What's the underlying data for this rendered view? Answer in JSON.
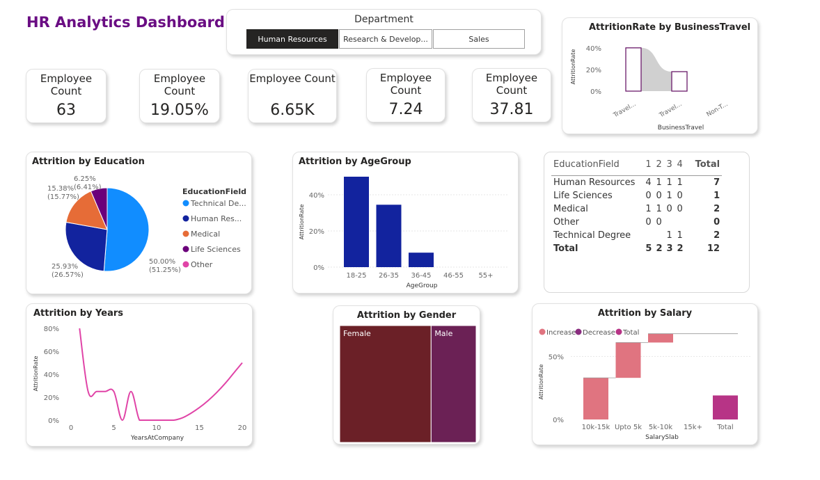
{
  "dashboard_title": "HR Analytics Dashboard",
  "slicer": {
    "title": "Department",
    "options": [
      "Human Resources",
      "Research & Develop...",
      "Sales"
    ],
    "selected": "Human Resources"
  },
  "kpis": [
    {
      "label": "Employee Count",
      "value": "63"
    },
    {
      "label": "Employee Count",
      "value": "19.05%"
    },
    {
      "label": "Employee Count",
      "value": "6.65K"
    },
    {
      "label": "Employee Count",
      "value": "7.24"
    },
    {
      "label": "Employee Count",
      "value": "37.81"
    }
  ],
  "colors": {
    "title_purple": "#6a0d83",
    "education": [
      "#118dff",
      "#12239e",
      "#e66c37",
      "#6b007b",
      "#e044a7"
    ],
    "age_bar": "#12239e",
    "years_line": "#e044a7",
    "gender_female": "#6b2027",
    "gender_male": "#6b2155",
    "salary_increase": "#e07480",
    "salary_decrease": "#8a2d7f",
    "salary_total": "#b73486",
    "travel_bar_border": "#6a1a6a",
    "travel_ribbon": "#c8c8c8"
  },
  "chart_data": [
    {
      "id": "travel",
      "type": "bar",
      "title": "AttritionRate by BusinessTravel",
      "xlabel": "BusinessTravel",
      "ylabel": "AttritionRate",
      "categories": [
        "Travel...",
        "Travel...",
        "Non-T..."
      ],
      "values": [
        40,
        18,
        0
      ],
      "ylim": [
        0,
        45
      ],
      "yticks": [
        "0%",
        "20%",
        "40%"
      ],
      "ytick_values": [
        0,
        20,
        40
      ]
    },
    {
      "id": "education",
      "type": "pie",
      "title": "Attrition by Education",
      "legend_title": "EducationField",
      "legend": [
        "Technical De...",
        "Human Res...",
        "Medical",
        "Life Sciences",
        "Other"
      ],
      "values": [
        51.25,
        26.57,
        15.77,
        6.41,
        0
      ],
      "labels": [
        {
          "pct": "50.00%",
          "sub": "(51.25%)"
        },
        {
          "pct": "25.93%",
          "sub": "(26.57%)"
        },
        {
          "pct": "15.38%",
          "sub": "(15.77%)"
        },
        {
          "pct": "6.25%",
          "sub": "(6.41%)"
        }
      ]
    },
    {
      "id": "age",
      "type": "bar",
      "title": "Attrition by AgeGroup",
      "xlabel": "AgeGroup",
      "ylabel": "AttritionRate",
      "categories": [
        "18-25",
        "26-35",
        "36-45",
        "46-55",
        "55+"
      ],
      "values": [
        50,
        34.5,
        8,
        0,
        0
      ],
      "ylim": [
        0,
        50
      ],
      "yticks": [
        "0%",
        "20%",
        "40%"
      ],
      "ytick_values": [
        0,
        20,
        40
      ]
    },
    {
      "id": "table",
      "type": "table",
      "corner": "EducationField",
      "columns": [
        "1",
        "2",
        "3",
        "4",
        "Total"
      ],
      "rows": [
        {
          "name": "Human Resources",
          "cells": [
            "4",
            "1",
            "1",
            "1",
            "7"
          ]
        },
        {
          "name": "Life Sciences",
          "cells": [
            "0",
            "0",
            "1",
            "0",
            "1"
          ]
        },
        {
          "name": "Medical",
          "cells": [
            "1",
            "1",
            "0",
            "0",
            "2"
          ]
        },
        {
          "name": "Other",
          "cells": [
            "0",
            "0",
            "",
            "",
            "0"
          ]
        },
        {
          "name": "Technical Degree",
          "cells": [
            "",
            "",
            "1",
            "1",
            "2"
          ]
        }
      ],
      "total": {
        "name": "Total",
        "cells": [
          "5",
          "2",
          "3",
          "2",
          "12"
        ]
      }
    },
    {
      "id": "years",
      "type": "line",
      "title": "Attrition by Years",
      "xlabel": "YearsAtCompany",
      "ylabel": "AttritionRate",
      "x": [
        1,
        2,
        3,
        4,
        5,
        6,
        7,
        8,
        9,
        10,
        11,
        12,
        13,
        14,
        15,
        16,
        17,
        18,
        19,
        20
      ],
      "y": [
        80,
        25,
        25,
        25,
        25,
        0,
        25,
        0,
        0,
        0,
        0,
        0,
        2,
        6,
        11,
        17,
        24,
        32,
        41,
        50
      ],
      "xlim": [
        0,
        20
      ],
      "ylim": [
        0,
        80
      ],
      "xticks": [
        0,
        5,
        10,
        15,
        20
      ],
      "ytick_values": [
        0,
        20,
        40,
        60,
        80
      ],
      "yticks": [
        "0%",
        "20%",
        "40%",
        "60%",
        "80%"
      ]
    },
    {
      "id": "gender",
      "type": "treemap",
      "title": "Attrition by Gender",
      "categories": [
        "Female",
        "Male"
      ],
      "values": [
        67,
        33
      ]
    },
    {
      "id": "salary",
      "type": "waterfall",
      "title": "Attrition by Salary",
      "xlabel": "SalarySlab",
      "ylabel": "AttritionRate",
      "legend": [
        "Increase",
        "Decrease",
        "Total"
      ],
      "categories": [
        "10k-15k",
        "Upto 5k",
        "5k-10k",
        "15k+",
        "Total"
      ],
      "deltas": [
        33,
        28,
        7,
        0
      ],
      "total": 19.05,
      "ylim": [
        0,
        75
      ],
      "yticks": [
        "0%",
        "50%"
      ],
      "ytick_values": [
        0,
        50
      ]
    }
  ]
}
